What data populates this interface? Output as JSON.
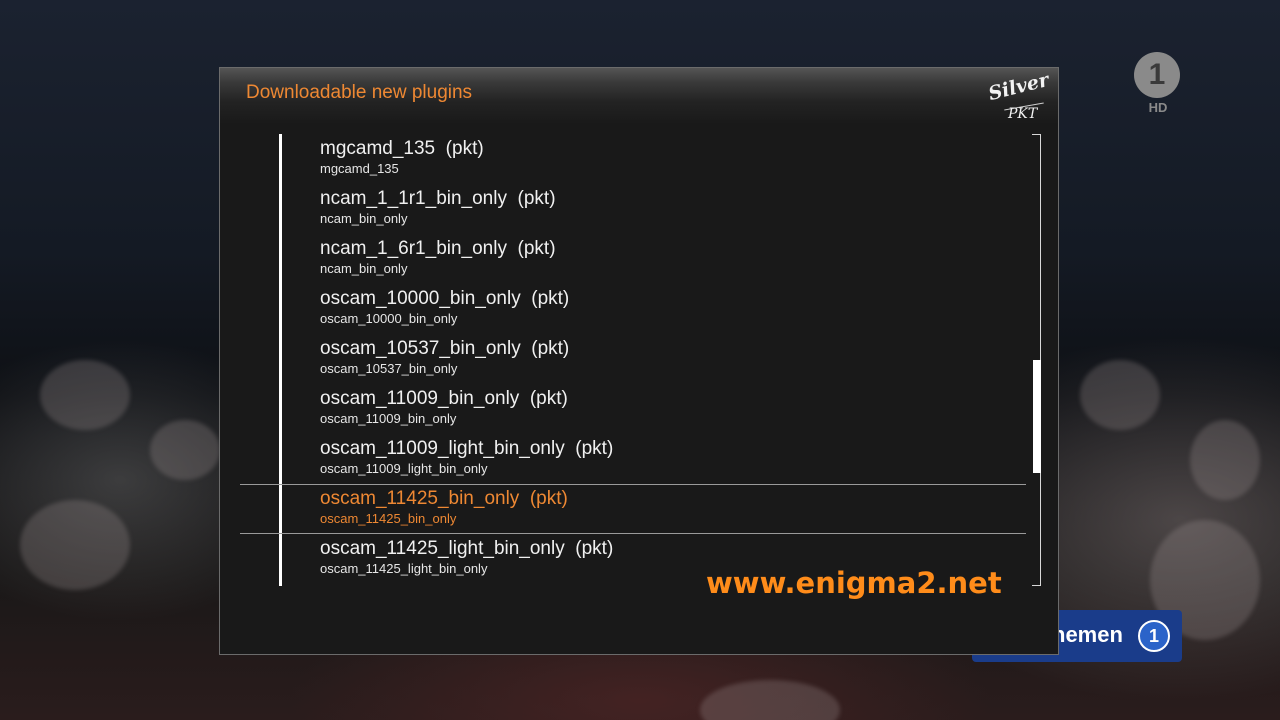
{
  "dialog": {
    "title": "Downloadable new plugins",
    "skin_logo_top": "Silver",
    "skin_logo_bottom": "PKT"
  },
  "plugins": [
    {
      "name": "mgcamd_135  (pkt)",
      "description": "mgcamd_135",
      "selected": false
    },
    {
      "name": "ncam_1_1r1_bin_only  (pkt)",
      "description": "ncam_bin_only",
      "selected": false
    },
    {
      "name": "ncam_1_6r1_bin_only  (pkt)",
      "description": "ncam_bin_only",
      "selected": false
    },
    {
      "name": "oscam_10000_bin_only  (pkt)",
      "description": "oscam_10000_bin_only",
      "selected": false
    },
    {
      "name": "oscam_10537_bin_only  (pkt)",
      "description": "oscam_10537_bin_only",
      "selected": false
    },
    {
      "name": "oscam_11009_bin_only  (pkt)",
      "description": "oscam_11009_bin_only",
      "selected": false
    },
    {
      "name": "oscam_11009_light_bin_only  (pkt)",
      "description": "oscam_11009_light_bin_only",
      "selected": false
    },
    {
      "name": "oscam_11425_bin_only  (pkt)",
      "description": "oscam_11425_bin_only",
      "selected": true
    },
    {
      "name": "oscam_11425_light_bin_only  (pkt)",
      "description": "oscam_11425_light_bin_only",
      "selected": false
    }
  ],
  "scrollbar": {
    "position_fraction": 0.5,
    "visible_fraction": 0.25
  },
  "watermark": "www.enigma2.net",
  "tv_background": {
    "channel_logo": "1",
    "channel_logo_sub": "HD",
    "banner_text": "nemen",
    "banner_icon": "1"
  },
  "colors": {
    "accent": "#ee8833",
    "text": "#f0f0f0",
    "dialog_background": "#191919"
  }
}
